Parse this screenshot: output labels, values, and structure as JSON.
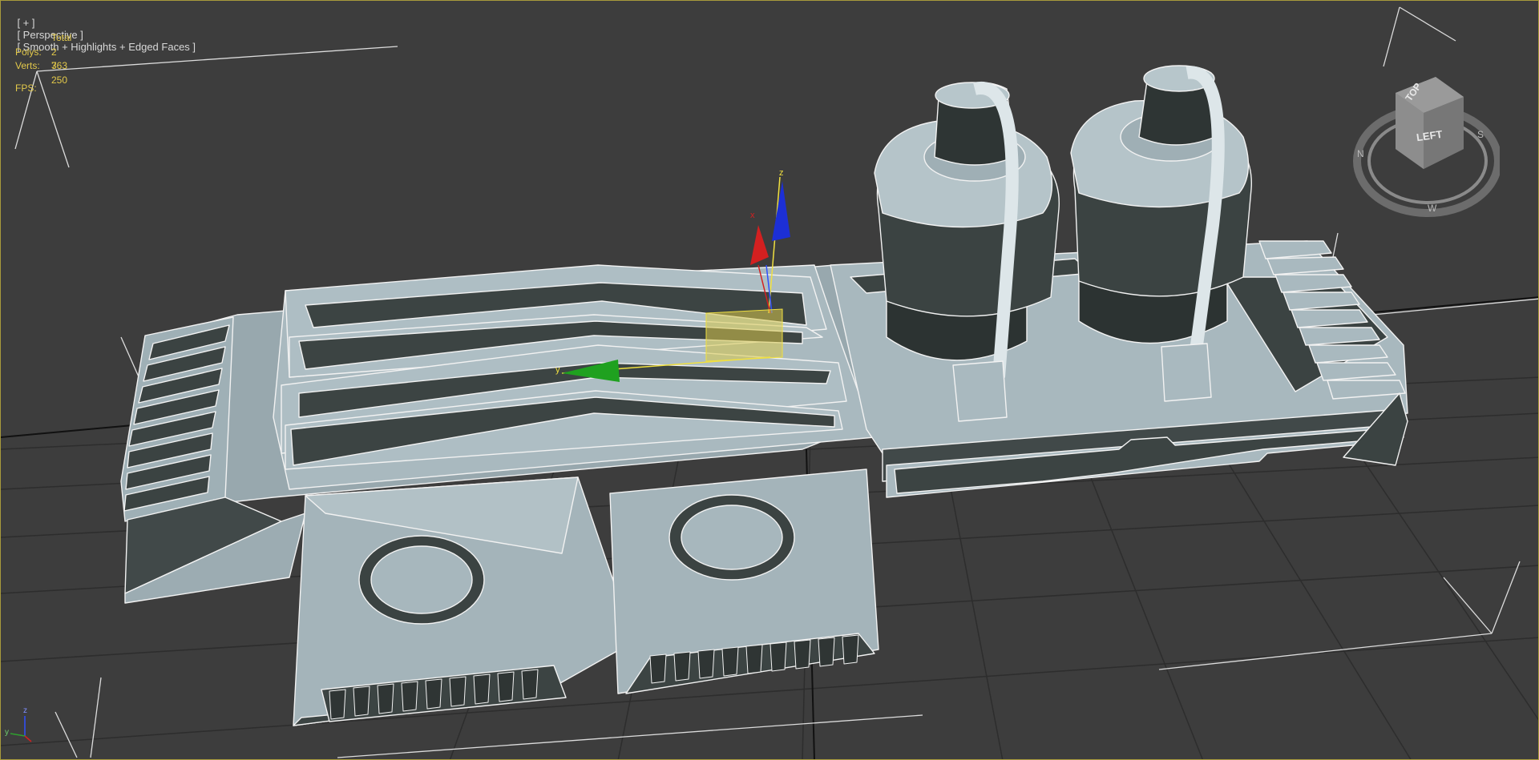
{
  "viewport": {
    "label_plus": "[ + ]",
    "label_view": "[ Perspective ]",
    "label_shading": "[ Smooth + Highlights + Edged Faces ]"
  },
  "stats": {
    "header": "Total",
    "polys_label": "Polys:",
    "polys_value": "2 763",
    "verts_label": "Verts:",
    "verts_value": "3 250",
    "fps_label": "FPS:"
  },
  "viewcube": {
    "top_label": "TOP",
    "left_label": "LEFT"
  },
  "gizmo": {
    "z_label": "z",
    "x_label": "x",
    "y_label": "y"
  },
  "world_axis": {
    "z_label": "z",
    "y_label": "y"
  },
  "colors": {
    "viewport_bg": "#3d3d3d",
    "grid": "#2d2d2d",
    "active_border": "#a89a3c",
    "mesh_fill": "#a6b6bc",
    "mesh_dark": "#39403f",
    "wire": "#f2f2f2",
    "stats_text": "#e3c94a",
    "gizmo_x": "#d42020",
    "gizmo_y": "#1fa11f",
    "gizmo_z": "#1c2fd6"
  }
}
